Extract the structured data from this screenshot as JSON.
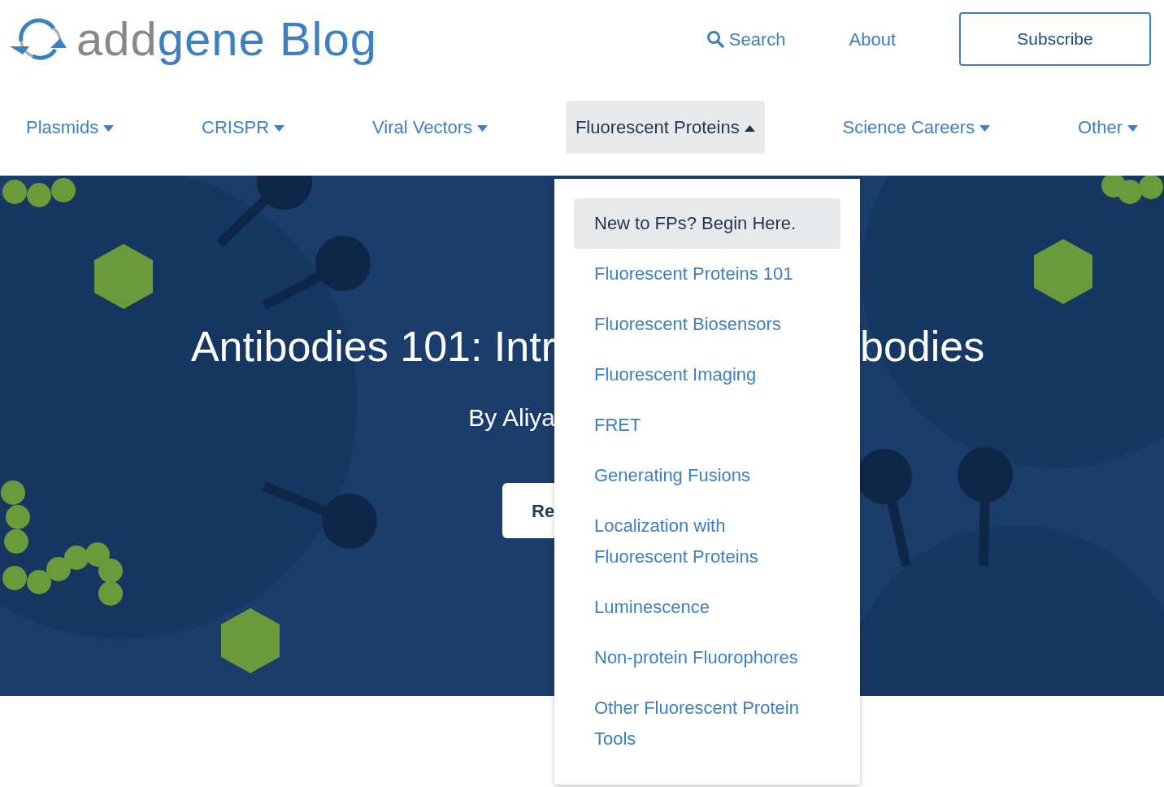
{
  "header": {
    "logo": {
      "part_1": "add",
      "part_2": "gene",
      "part_3": "Blog"
    },
    "links": [
      {
        "kind": "search",
        "label": "Search"
      },
      {
        "kind": "plain",
        "label": "About"
      },
      {
        "kind": "outline",
        "label": "Subscribe"
      }
    ]
  },
  "nav": [
    {
      "label": "Plasmids",
      "expanded": false
    },
    {
      "label": "CRISPR",
      "expanded": false
    },
    {
      "label": "Viral Vectors",
      "expanded": false
    },
    {
      "label": "Fluorescent Proteins",
      "expanded": true
    },
    {
      "label": "Science Careers",
      "expanded": false
    },
    {
      "label": "Other",
      "expanded": false
    }
  ],
  "hero": {
    "title_left": "Antibodies 101: Intr",
    "title_right": "bodies",
    "byline": "By Aliya",
    "button": "Re"
  },
  "dropdown": [
    {
      "label": "New to FPs? Begin Here.",
      "selected": true
    },
    {
      "label": "Fluorescent Proteins 101",
      "selected": false
    },
    {
      "label": "Fluorescent Biosensors",
      "selected": false
    },
    {
      "label": "Fluorescent Imaging",
      "selected": false
    },
    {
      "label": "FRET",
      "selected": false
    },
    {
      "label": "Generating Fusions",
      "selected": false
    },
    {
      "label": "Localization with Fluorescent Proteins",
      "selected": false
    },
    {
      "label": "Luminescence",
      "selected": false
    },
    {
      "label": "Non-protein Fluorophores",
      "selected": false
    },
    {
      "label": "Other Fluorescent Protein Tools",
      "selected": false
    }
  ]
}
